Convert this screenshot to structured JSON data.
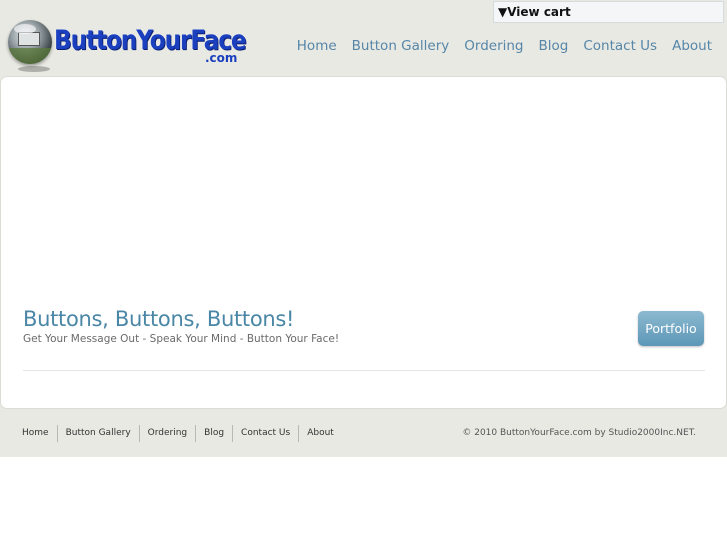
{
  "logo": {
    "text": "ButtonYourFace",
    "suffix": ".com"
  },
  "cart": {
    "label": "▼View cart"
  },
  "nav": {
    "items": [
      {
        "label": "Home"
      },
      {
        "label": "Button Gallery"
      },
      {
        "label": "Ordering"
      },
      {
        "label": "Blog"
      },
      {
        "label": "Contact Us"
      },
      {
        "label": "About"
      }
    ]
  },
  "hero": {
    "title": "Buttons, Buttons, Buttons!",
    "subtitle": "Get Your Message Out - Speak Your Mind - Button Your Face!",
    "button_label": "Portfolio"
  },
  "footer": {
    "links": [
      {
        "label": "Home"
      },
      {
        "label": "Button Gallery"
      },
      {
        "label": "Ordering"
      },
      {
        "label": "Blog"
      },
      {
        "label": "Contact Us"
      },
      {
        "label": "About"
      }
    ],
    "copyright": "© 2010 ButtonYourFace.com by Studio2000Inc.NET."
  },
  "colors": {
    "band": "#e9e9e3",
    "nav_link": "#5686a8",
    "hero_title": "#4a86a6",
    "logo_blue": "#1a3fbf",
    "button": "#5d97b7"
  }
}
